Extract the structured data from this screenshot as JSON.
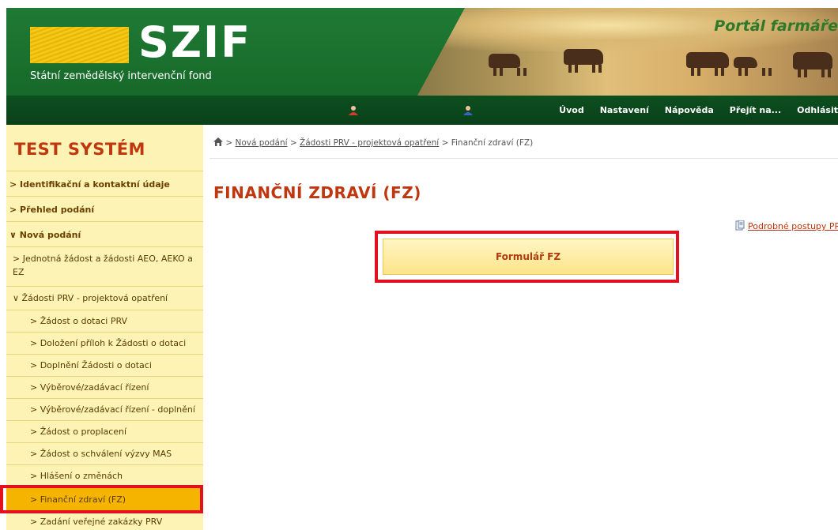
{
  "header": {
    "logo_text": "SZIF",
    "logo_subtitle": "Státní zemědělský intervenční fond",
    "portal_title": "Portál farmáře"
  },
  "nav": {
    "items": [
      "Úvod",
      "Nastavení",
      "Nápověda",
      "Přejít na...",
      "Odhlásit"
    ]
  },
  "sidebar": {
    "system_title": "TEST SYSTÉM",
    "items": [
      {
        "label": "> Identifikační a kontaktní údaje"
      },
      {
        "label": "> Přehled podání"
      },
      {
        "label": "∨ Nová podání"
      },
      {
        "label": "> Jednotná žádost a žádosti AEO, AEKO a EZ"
      },
      {
        "label": "∨ Žádosti PRV - projektová opatření"
      },
      {
        "label": "> Žádost o dotaci PRV"
      },
      {
        "label": "> Doložení příloh k Žádosti o dotaci"
      },
      {
        "label": "> Doplnění Žádosti o dotaci"
      },
      {
        "label": "> Výběrové/zadávací řízení"
      },
      {
        "label": "> Výběrové/zadávací řízení - doplnění"
      },
      {
        "label": "> Žádost o proplacení"
      },
      {
        "label": "> Žádost o schválení výzvy MAS"
      },
      {
        "label": "> Hlášení o změnách"
      },
      {
        "label": "> Finanční zdraví (FZ)"
      },
      {
        "label": "> Zadání veřejné zakázky PRV"
      }
    ]
  },
  "breadcrumb": {
    "sep": ">",
    "items": [
      "Nová podání",
      "Žádosti PRV - projektová opatření",
      "Finanční zdraví (FZ)"
    ]
  },
  "main": {
    "title": "FINANČNÍ ZDRAVÍ (FZ)",
    "help_link": "Podrobné postupy PR",
    "form_button": "Formulář FZ"
  },
  "colors": {
    "accent": "#c0360f",
    "nav_green": "#0c4f1f",
    "sidebar_bg": "#fdf3b4",
    "selected": "#f5b400",
    "highlight": "#e3111f"
  }
}
